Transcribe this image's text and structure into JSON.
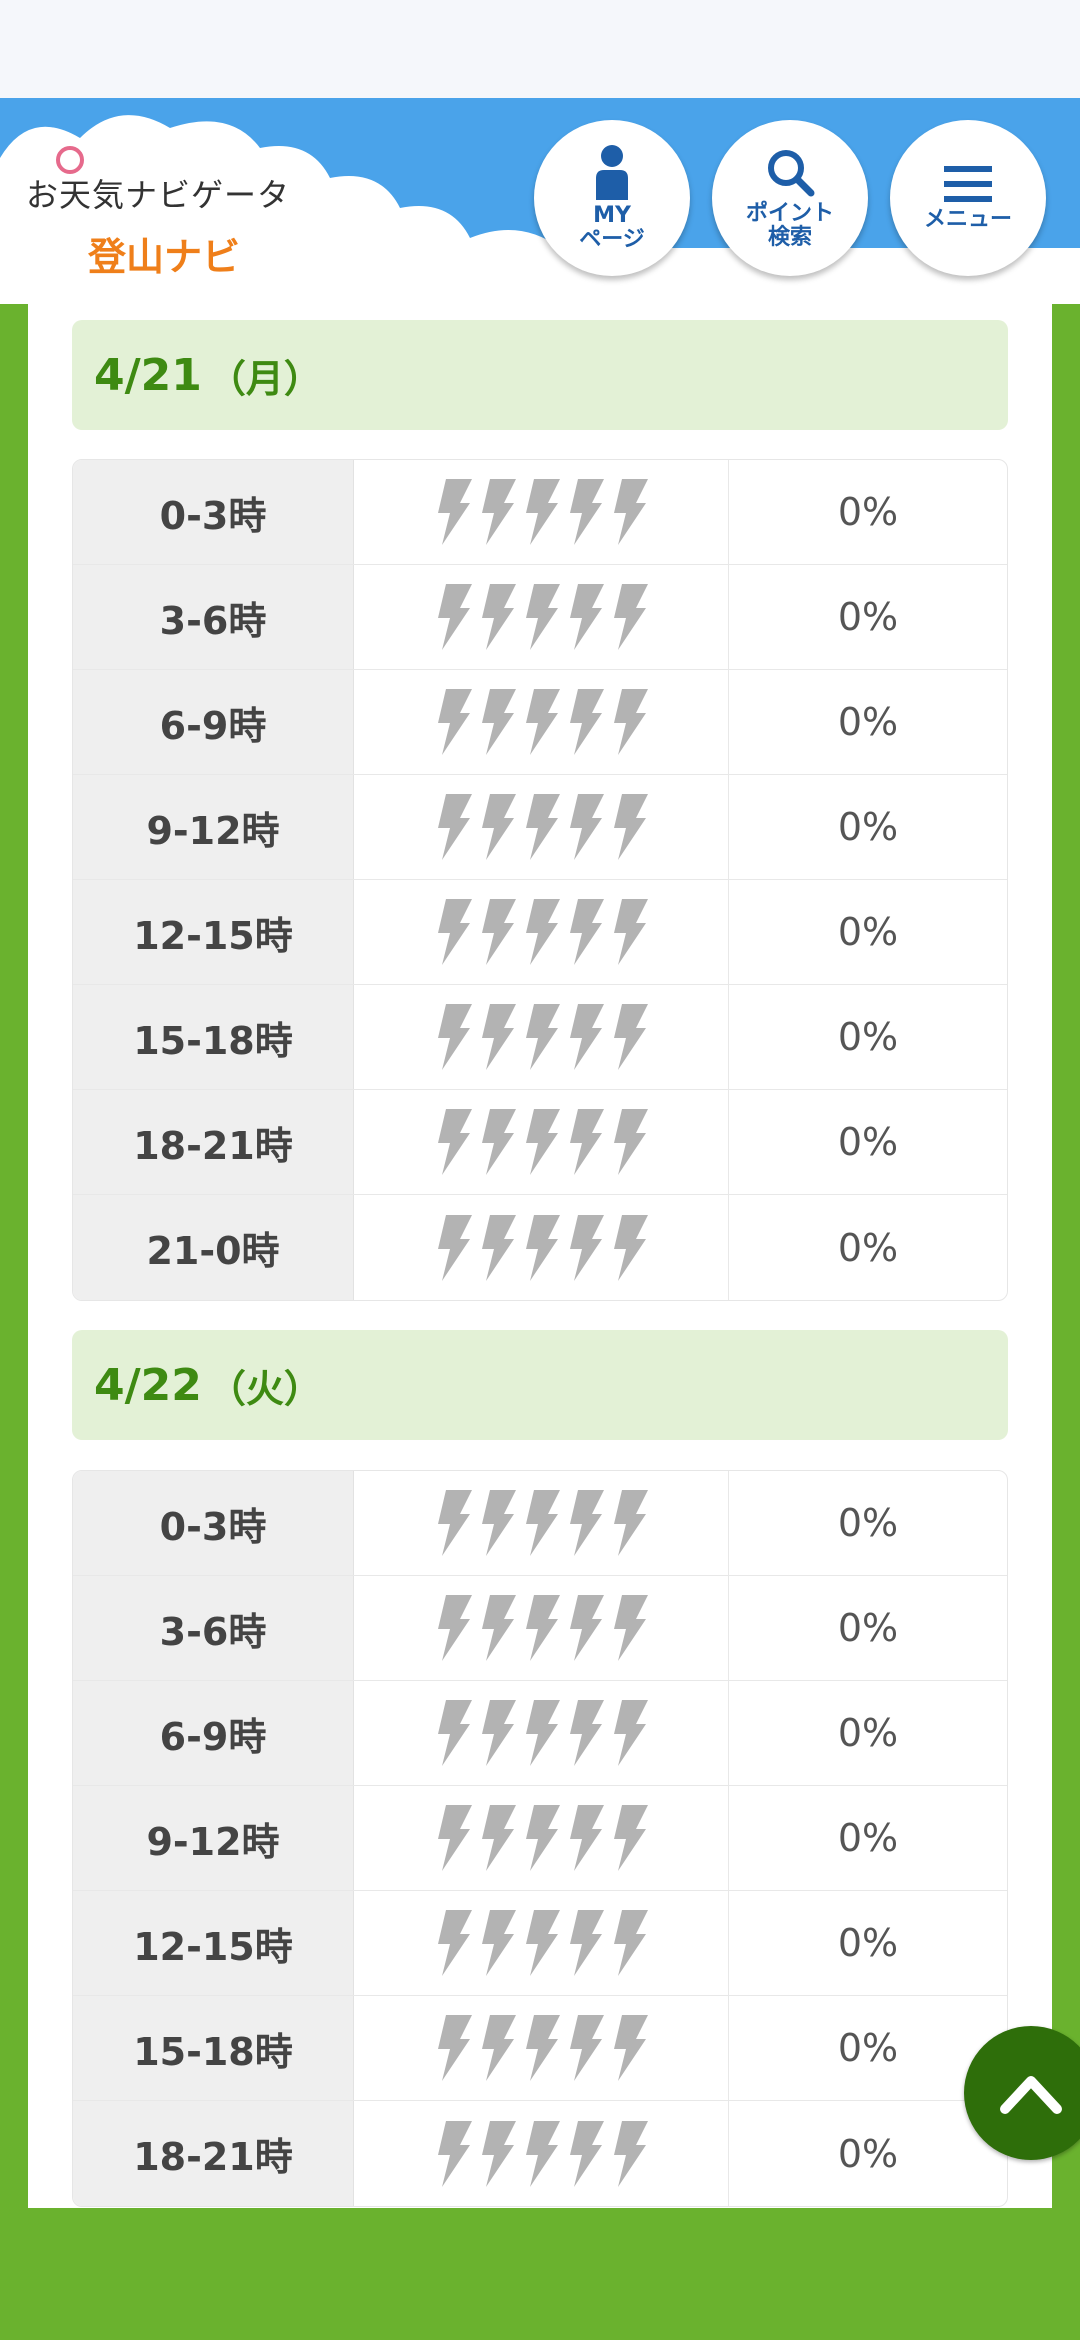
{
  "header": {
    "logo_line1": "お天気ナビゲータ",
    "logo_line2": "登山ナビ",
    "nav": [
      {
        "label": "MY\nページ",
        "icon": "person-icon"
      },
      {
        "label": "ポイント\n検索",
        "icon": "search-icon"
      },
      {
        "label": "メニュー",
        "icon": "menu-icon"
      }
    ]
  },
  "days": [
    {
      "date": "4/21",
      "dow": "（月）",
      "rows": [
        {
          "time": "0-3時",
          "pct": "0%"
        },
        {
          "time": "3-6時",
          "pct": "0%"
        },
        {
          "time": "6-9時",
          "pct": "0%"
        },
        {
          "time": "9-12時",
          "pct": "0%"
        },
        {
          "time": "12-15時",
          "pct": "0%"
        },
        {
          "time": "15-18時",
          "pct": "0%"
        },
        {
          "time": "18-21時",
          "pct": "0%"
        },
        {
          "time": "21-0時",
          "pct": "0%"
        }
      ]
    },
    {
      "date": "4/22",
      "dow": "（火）",
      "rows": [
        {
          "time": "0-3時",
          "pct": "0%"
        },
        {
          "time": "3-6時",
          "pct": "0%"
        },
        {
          "time": "6-9時",
          "pct": "0%"
        },
        {
          "time": "9-12時",
          "pct": "0%"
        },
        {
          "time": "12-15時",
          "pct": "0%"
        },
        {
          "time": "15-18時",
          "pct": "0%"
        },
        {
          "time": "18-21時",
          "pct": "0%"
        }
      ]
    }
  ],
  "icons": {
    "lightning": "lightning-icon",
    "scroll_top": "chevron-up-icon"
  },
  "colors": {
    "header_sky": "#4aa3ea",
    "page_green": "#6ab22e",
    "date_text": "#3e8a12",
    "bolt_gray": "#b3b3b3",
    "scroll_btn": "#2e6e0a"
  }
}
